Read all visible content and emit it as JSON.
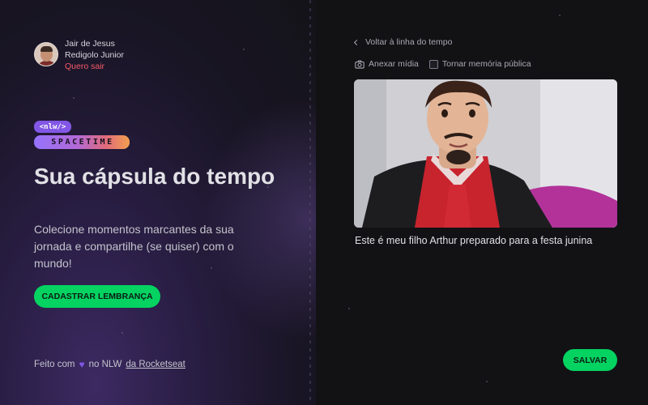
{
  "user": {
    "name_line1": "Jair de Jesus",
    "name_line2": "Redigolo Junior",
    "logout_label": "Quero sair"
  },
  "brand": {
    "badge": "<nlw/>",
    "wordmark": "SPACETIME"
  },
  "hero": {
    "title": "Sua cápsula do tempo",
    "description": "Colecione momentos marcantes da sua jornada e compartilhe (se quiser) com o mundo!",
    "cta_label": "CADASTRAR LEMBRANÇA"
  },
  "footer": {
    "prefix": "Feito com",
    "middle": "no NLW",
    "link_label": "da Rocketseat",
    "heart_icon": "heart-icon"
  },
  "memory": {
    "back_label": "Voltar à linha do tempo",
    "attach_label": "Anexar mídia",
    "public_label": "Tornar memória pública",
    "public_checked": false,
    "caption": "Este é meu filho Arthur preparado para a festa junina",
    "save_label": "SALVAR"
  },
  "colors": {
    "accent_green": "#04d361",
    "accent_purple": "#8257e5",
    "logout_red": "#f75a68",
    "background": "#121215"
  }
}
